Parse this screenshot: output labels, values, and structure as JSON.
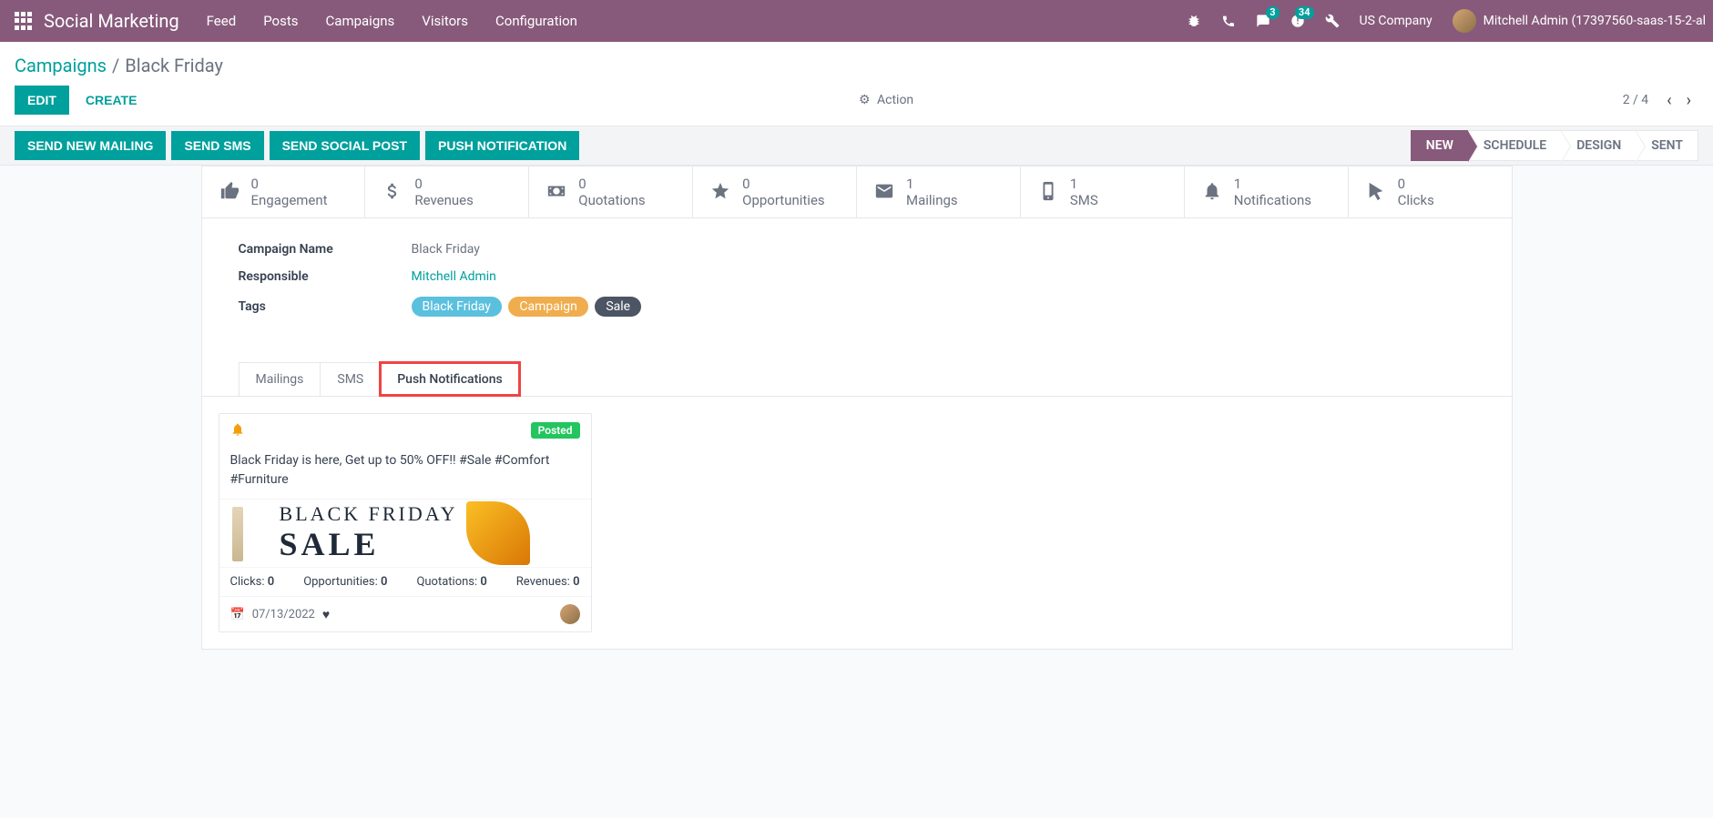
{
  "navbar": {
    "brand": "Social Marketing",
    "links": [
      "Feed",
      "Posts",
      "Campaigns",
      "Visitors",
      "Configuration"
    ],
    "messages_badge": "3",
    "activities_badge": "34",
    "company": "US Company",
    "username": "Mitchell Admin (17397560-saas-15-2-al"
  },
  "breadcrumb": {
    "parent": "Campaigns",
    "current": "Black Friday"
  },
  "controls": {
    "edit": "EDIT",
    "create": "CREATE",
    "action": "Action",
    "pager": "2 / 4"
  },
  "buttons": {
    "mailing": "SEND NEW MAILING",
    "sms": "SEND SMS",
    "social": "SEND SOCIAL POST",
    "push": "PUSH NOTIFICATION"
  },
  "stages": [
    "NEW",
    "SCHEDULE",
    "DESIGN",
    "SENT"
  ],
  "active_stage": "NEW",
  "stats": [
    {
      "icon": "thumbs-up",
      "value": "0",
      "label": "Engagement"
    },
    {
      "icon": "dollar",
      "value": "0",
      "label": "Revenues"
    },
    {
      "icon": "money-bill",
      "value": "0",
      "label": "Quotations"
    },
    {
      "icon": "star",
      "value": "0",
      "label": "Opportunities"
    },
    {
      "icon": "envelope",
      "value": "1",
      "label": "Mailings"
    },
    {
      "icon": "mobile",
      "value": "1",
      "label": "SMS"
    },
    {
      "icon": "bell",
      "value": "1",
      "label": "Notifications"
    },
    {
      "icon": "cursor",
      "value": "0",
      "label": "Clicks"
    }
  ],
  "fields": {
    "campaign_name_label": "Campaign Name",
    "campaign_name": "Black Friday",
    "responsible_label": "Responsible",
    "responsible": "Mitchell Admin",
    "tags_label": "Tags",
    "tags": [
      {
        "text": "Black Friday",
        "color": "blue"
      },
      {
        "text": "Campaign",
        "color": "orange"
      },
      {
        "text": "Sale",
        "color": "dark"
      }
    ]
  },
  "tabs": [
    "Mailings",
    "SMS",
    "Push Notifications"
  ],
  "active_tab": "Push Notifications",
  "card": {
    "status": "Posted",
    "message": "Black Friday is here, Get up to 50% OFF!! #Sale #Comfort #Furniture",
    "img_line1": "BLACK FRIDAY",
    "img_line2": "SALE",
    "stats": {
      "clicks_label": "Clicks:",
      "clicks": "0",
      "opps_label": "Opportunities:",
      "opps": "0",
      "quot_label": "Quotations:",
      "quot": "0",
      "rev_label": "Revenues:",
      "rev": "0"
    },
    "date": "07/13/2022"
  }
}
